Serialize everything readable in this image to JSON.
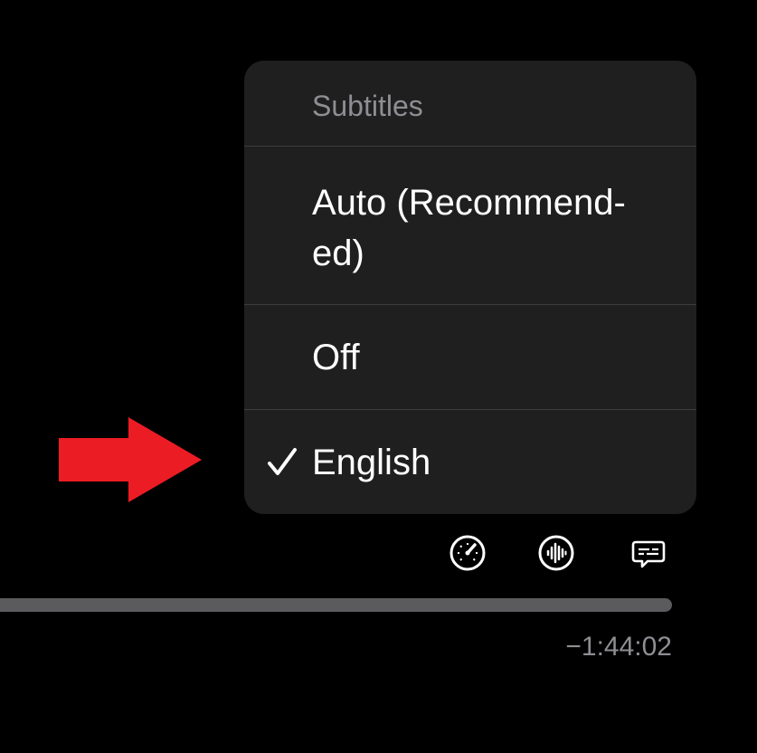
{
  "subtitles_menu": {
    "title": "Subtitles",
    "items": [
      {
        "label": "Auto (Recommended-ed)",
        "line1": "Auto (Recommend-",
        "line2": "ed)",
        "selected": false
      },
      {
        "label": "Off",
        "selected": false
      },
      {
        "label": "English",
        "selected": true
      }
    ]
  },
  "controls": {
    "icons": [
      "playback-speed-icon",
      "audio-track-icon",
      "subtitles-icon"
    ]
  },
  "timeline": {
    "remaining_time": "−1:44:02"
  },
  "colors": {
    "background": "#000000",
    "menu_bg": "#1f1f1f",
    "annotation_arrow": "#ec1c24",
    "secondary_text": "#8e8e93"
  }
}
